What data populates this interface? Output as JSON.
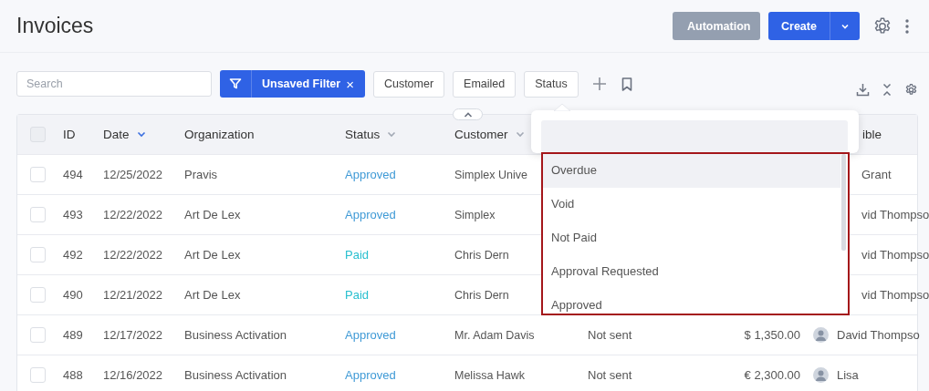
{
  "header": {
    "title": "Invoices",
    "automation_button": "Automation",
    "create_button": "Create"
  },
  "toolbar": {
    "search": {
      "placeholder": "Search"
    },
    "filter": {
      "label": "Unsaved Filter",
      "close": "×"
    },
    "chips": [
      "Customer",
      "Emailed",
      "Status"
    ]
  },
  "table": {
    "collapse_toggle": {
      "expanded": true
    },
    "select_all": {
      "checked": false
    },
    "columns": [
      {
        "label": "ID",
        "kind": "plain"
      },
      {
        "label": "Date",
        "kind": "sortable",
        "sorted": true
      },
      {
        "label": "Organization",
        "kind": "plain"
      },
      {
        "label": "Status",
        "kind": "sortable",
        "sorted": false
      },
      {
        "label": "Customer",
        "kind": "sortable",
        "sorted": false
      },
      {
        "label": "ible",
        "kind": "cut"
      }
    ],
    "rows": [
      {
        "checked": false,
        "id": "494",
        "date": "12/25/2022",
        "organization": "Pravis",
        "status": "Approved",
        "color": "#3f9ad6",
        "customer": "Simplex Unive",
        "avatar": false,
        "responsible": "Grant"
      },
      {
        "checked": false,
        "id": "493",
        "date": "12/22/2022",
        "organization": "Art De Lex",
        "status": "Approved",
        "color": "#3f9ad6",
        "customer": "Simplex",
        "avatar": false,
        "responsible": "vid Thompso"
      },
      {
        "checked": false,
        "id": "492",
        "date": "12/22/2022",
        "organization": "Art De Lex",
        "status": "Paid",
        "color": "#27bfcf",
        "customer": "Chris Dern",
        "avatar": false,
        "responsible": "vid Thompso"
      },
      {
        "checked": false,
        "id": "490",
        "date": "12/21/2022",
        "organization": "Art De Lex",
        "status": "Paid",
        "color": "#27bfcf",
        "customer": "Chris Dern",
        "avatar": false,
        "responsible": "vid Thompso"
      },
      {
        "checked": false,
        "id": "489",
        "date": "12/17/2022",
        "organization": "Business Activation",
        "status": "Approved",
        "color": "#3f9ad6",
        "customer": "Mr. Adam Davis",
        "emailed": "Not sent",
        "amount": "$ 1,350.00",
        "avatar": true,
        "responsible": "David Thompso"
      },
      {
        "checked": false,
        "id": "488",
        "date": "12/16/2022",
        "organization": "Business Activation",
        "status": "Approved",
        "color": "#3f9ad6",
        "customer": "Melissa Hawk",
        "emailed": "Not sent",
        "amount": "€ 2,300.00",
        "avatar": true,
        "responsible": "Lisa"
      }
    ]
  },
  "status_dropdown": {
    "items": [
      {
        "label": "Overdue",
        "selected": true
      },
      {
        "label": "Void",
        "selected": false
      },
      {
        "label": "Not Paid",
        "selected": false
      },
      {
        "label": "Approval Requested",
        "selected": false
      },
      {
        "label": "Approved",
        "selected": false
      }
    ]
  }
}
